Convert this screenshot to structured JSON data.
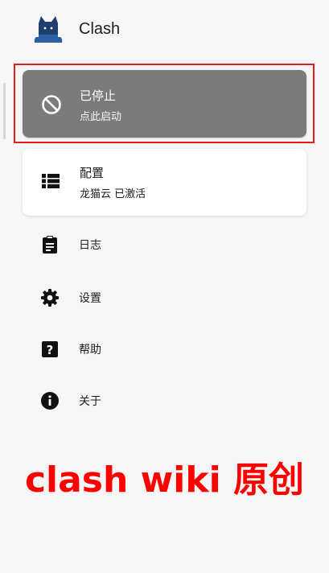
{
  "app": {
    "title": "Clash"
  },
  "status_card": {
    "title": "已停止",
    "subtitle": "点此启动",
    "background": "#7b7b7b"
  },
  "profile_card": {
    "title": "配置",
    "subtitle": "龙猫云 已激活"
  },
  "menu": [
    {
      "label": "日志",
      "icon": "clipboard-icon"
    },
    {
      "label": "设置",
      "icon": "gear-icon"
    },
    {
      "label": "帮助",
      "icon": "question-icon"
    },
    {
      "label": "关于",
      "icon": "info-icon"
    }
  ],
  "watermark": {
    "text": "clash wiki 原创",
    "color": "#ff0000"
  },
  "colors": {
    "highlight": "#e51b1b",
    "background": "#f6f6f6"
  }
}
